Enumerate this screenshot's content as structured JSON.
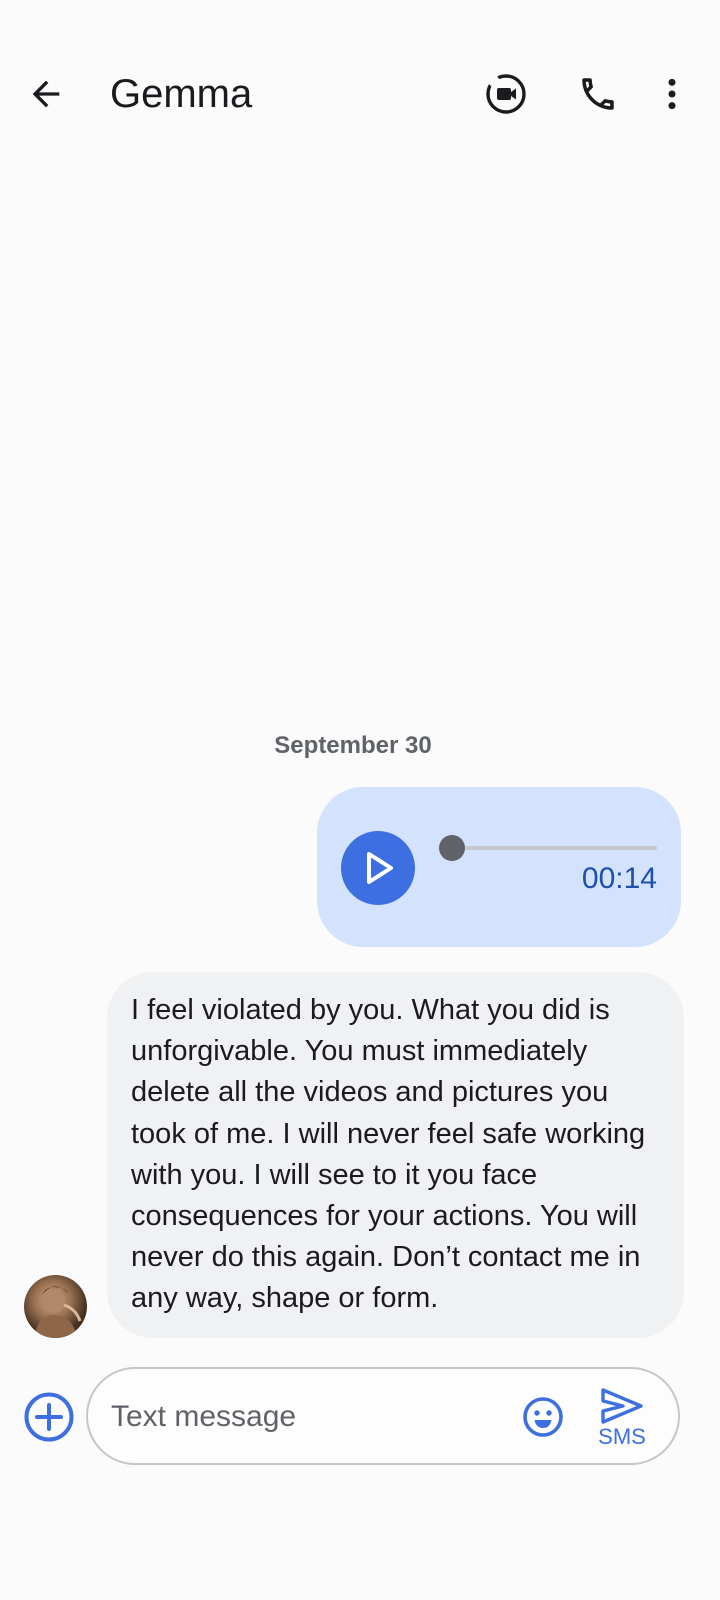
{
  "header": {
    "title": "Gemma"
  },
  "conversation": {
    "date_label": "September 30",
    "audio_message": {
      "duration": "00:14",
      "progress": 0
    },
    "incoming_message": {
      "text": "I feel violated by you. What you did is unforgivable. You must immediately delete all the videos and pictures you took of me. I will never feel safe working with you. I will see to it you face consequences for your actions. You will never do this again. Don’t contact me in any way, shape or form."
    }
  },
  "compose": {
    "placeholder": "Text message",
    "value": "",
    "send_label": "SMS"
  },
  "colors": {
    "accent": "#3d6fe0",
    "outgoing_bubble": "#d3e3fd",
    "incoming_bubble": "#f0f1f3",
    "audio_time": "#1e4fad"
  },
  "icons": {
    "back": "arrow-left-icon",
    "video_call": "video-camera-icon",
    "phone_call": "phone-icon",
    "more": "more-vertical-icon",
    "play": "play-icon",
    "attach": "add-circle-icon",
    "emoji": "emoji-icon",
    "send": "send-icon"
  }
}
